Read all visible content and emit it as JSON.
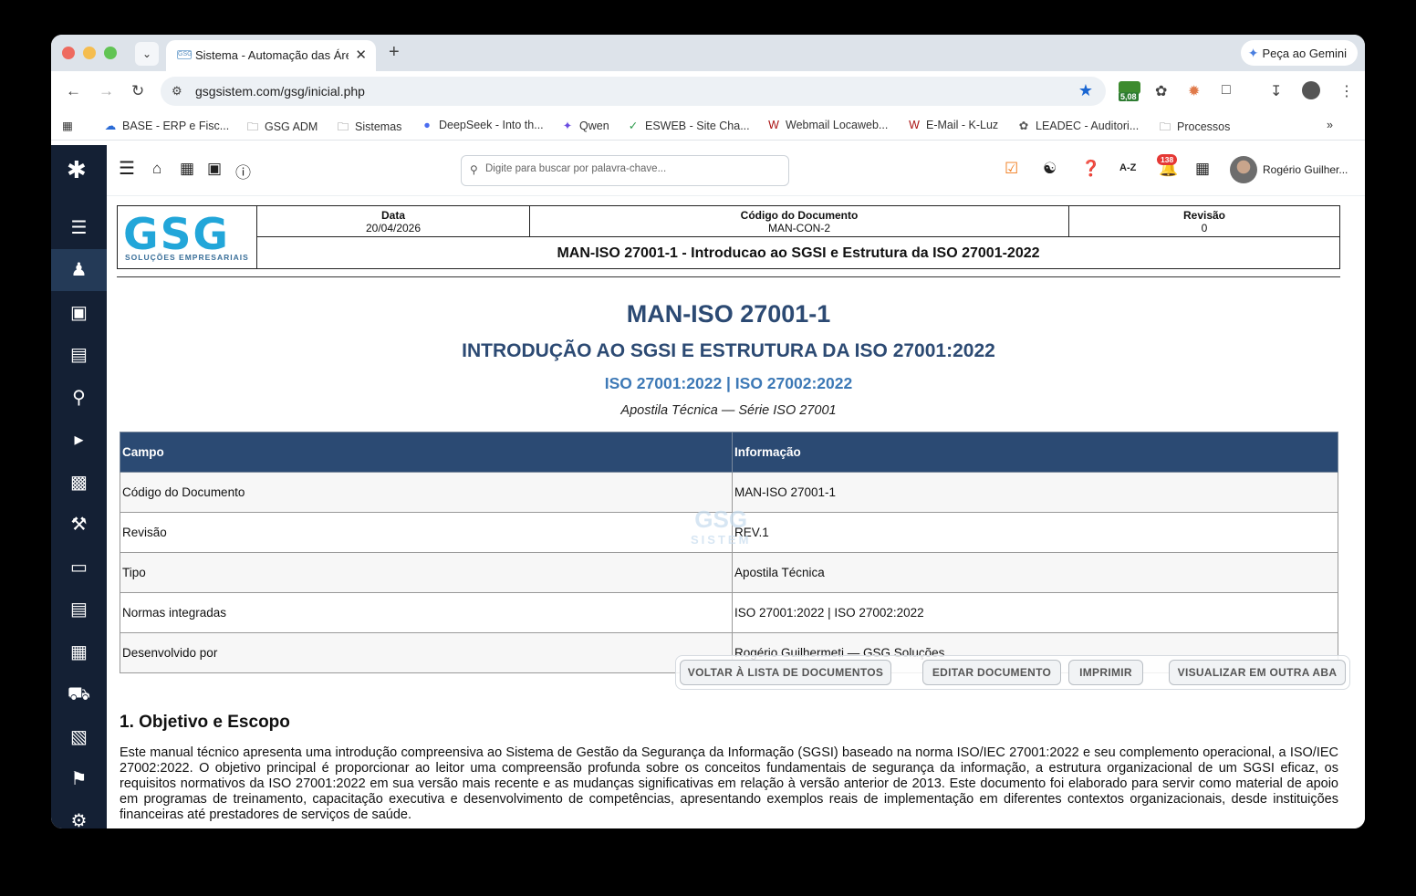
{
  "browser": {
    "tab_title": "Sistema - Automação das Áreas",
    "gemini_label": "Peça ao Gemini",
    "url": "gsgsistem.com/gsg/inicial.php",
    "ext_badge": "5,08",
    "bookmarks": [
      {
        "label": "BASE - ERP e Fisc..."
      },
      {
        "label": "GSG ADM"
      },
      {
        "label": "Sistemas"
      },
      {
        "label": "DeepSeek - Into th..."
      },
      {
        "label": "Qwen"
      },
      {
        "label": "ESWEB - Site Cha..."
      },
      {
        "label": "Webmail Locaweb..."
      },
      {
        "label": "E-Mail - K-Luz"
      },
      {
        "label": "LEADEC - Auditori..."
      },
      {
        "label": "Processos"
      }
    ]
  },
  "app": {
    "search_placeholder": "Digite para buscar por palavra-chave...",
    "az_label": "A-Z",
    "notifications_count": "138",
    "user_name": "Rogério Guilher..."
  },
  "doc_header": {
    "logo": "GSG",
    "logo_sub": "SOLUÇÕES EMPRESARIAIS",
    "date_label": "Data",
    "date_value": "20/04/2026",
    "code_label": "Código do Documento",
    "code_value": "MAN-CON-2",
    "rev_label": "Revisão",
    "rev_value": "0",
    "title": "MAN-ISO 27001-1 - Introducao ao SGSI e Estrutura da ISO 27001-2022"
  },
  "doc": {
    "title": "MAN-ISO 27001-1",
    "subtitle": "INTRODUÇÃO AO SGSI E ESTRUTURA DA ISO 27001:2022",
    "norms": "ISO 27001:2022 | ISO 27002:2022",
    "series": "Apostila Técnica — Série ISO 27001",
    "table_headers": [
      "Campo",
      "Informação"
    ],
    "table_rows": [
      [
        "Código do Documento",
        "MAN-ISO 27001-1"
      ],
      [
        "Revisão",
        "REV.1"
      ],
      [
        "Tipo",
        "Apostila Técnica"
      ],
      [
        "Normas integradas",
        "ISO 27001:2022 | ISO 27002:2022"
      ],
      [
        "Desenvolvido por",
        "Rogério Guilhermeti — GSG Soluções"
      ]
    ],
    "watermark": "GSG",
    "watermark_sub": "SISTEM",
    "section_title": "1. Objetivo e Escopo",
    "paragraph": "Este manual técnico apresenta uma introdução compreensiva ao Sistema de Gestão da Segurança da Informação (SGSI) baseado na norma ISO/IEC 27001:2022 e seu complemento operacional, a ISO/IEC 27002:2022. O objetivo principal é proporcionar ao leitor uma compreensão profunda sobre os conceitos fundamentais de segurança da informação, a estrutura organizacional de um SGSI eficaz, os requisitos normativos da ISO 27001:2022 em sua versão mais recente e as mudanças significativas em relação à versão anterior de 2013. Este documento foi elaborado para servir como material de apoio em programas de treinamento, capacitação executiva e desenvolvimento de competências, apresentando exemplos reais de implementação em diferentes contextos organizacionais, desde instituições financeiras até prestadores de serviços de saúde."
  },
  "actions": {
    "back": "VOLTAR À LISTA DE DOCUMENTOS",
    "edit": "EDITAR DOCUMENTO",
    "print": "IMPRIMIR",
    "open_tab": "VISUALIZAR EM OUTRA ABA"
  },
  "colors": {
    "sidebar": "#142034",
    "table_header": "#2b4a73",
    "title": "#2c4a73",
    "accent_blue": "#3d79b6",
    "logo": "#22a6d9"
  }
}
